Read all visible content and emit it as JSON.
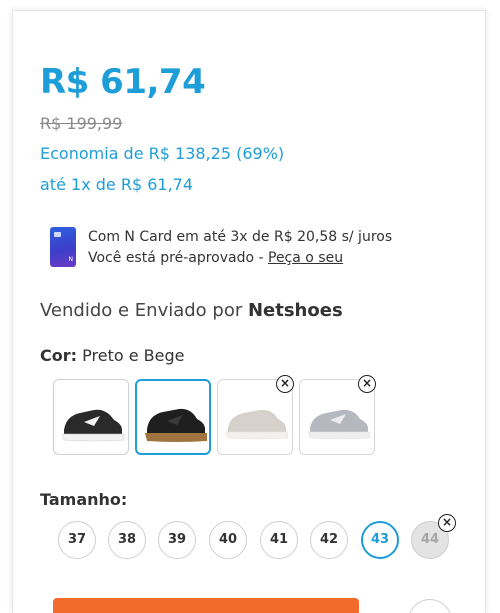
{
  "price": {
    "current": "R$ 61,74",
    "original": "R$ 199,99",
    "savings": "Economia de R$ 138,25 (69%)",
    "installment": "até 1x de R$ 61,74"
  },
  "ncard": {
    "icon": "credit-card-icon",
    "line1": "Com N Card em até 3x de R$ 20,58 s/ juros",
    "line2_prefix": "Você está pré-aprovado - ",
    "line2_link": "Peça o seu"
  },
  "seller": {
    "prefix": "Vendido e Enviado por ",
    "name": "Netshoes"
  },
  "color": {
    "label": "Cor:",
    "selected": "Preto e Bege",
    "swatches": [
      {
        "color": "#2a2a2a",
        "sole": "#f2f2f2",
        "available": true,
        "selected": false
      },
      {
        "color": "#1f1f1f",
        "sole": "#a0743f",
        "available": true,
        "selected": true
      },
      {
        "color": "#cfcac2",
        "sole": "#f0efec",
        "available": false,
        "selected": false
      },
      {
        "color": "#a9adb5",
        "sole": "#ececec",
        "available": false,
        "selected": false
      }
    ]
  },
  "size": {
    "label": "Tamanho:",
    "options": [
      {
        "value": "37",
        "state": "available"
      },
      {
        "value": "38",
        "state": "available"
      },
      {
        "value": "39",
        "state": "available"
      },
      {
        "value": "40",
        "state": "available"
      },
      {
        "value": "41",
        "state": "available"
      },
      {
        "value": "42",
        "state": "available"
      },
      {
        "value": "43",
        "state": "selected"
      },
      {
        "value": "44",
        "state": "unavailable"
      }
    ]
  },
  "colors": {
    "accent": "#1e9ed9",
    "buy": "#f26b2a",
    "muted": "#8a8a8a"
  }
}
